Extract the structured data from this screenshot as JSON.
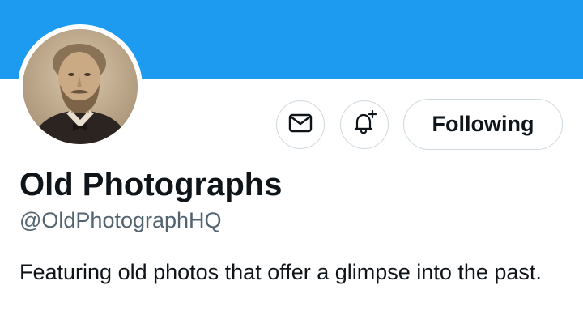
{
  "profile": {
    "display_name": "Old Photographs",
    "handle": "@OldPhotographHQ",
    "bio": "Featuring old photos that offer a glimpse into the past."
  },
  "actions": {
    "message_icon": "envelope-icon",
    "notify_icon": "bell-plus-icon",
    "follow_label": "Following"
  },
  "colors": {
    "banner": "#1d9bf0",
    "text_primary": "#0f1419",
    "text_secondary": "#536471",
    "button_border": "#cfd9de"
  }
}
